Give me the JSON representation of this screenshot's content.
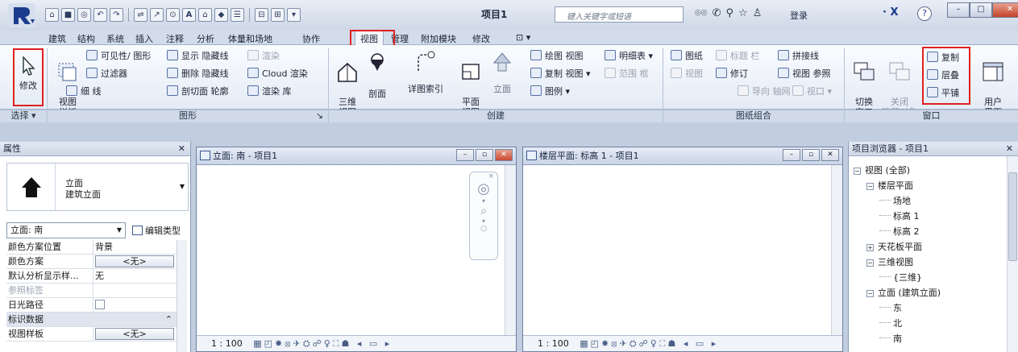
{
  "titlebar": {
    "doc_title": "项目1",
    "search_placeholder": "键入关键字或短语",
    "login_label": "登录",
    "help_label": "?"
  },
  "tabs": [
    "建筑",
    "结构",
    "系统",
    "插入",
    "注释",
    "分析",
    "体量和场地",
    "协作",
    "视图",
    "管理",
    "附加模块",
    "修改",
    "⊡ ▾"
  ],
  "active_tab": "视图",
  "ribbon": {
    "modify_label": "修改",
    "select_label": "选择 ▾",
    "graphics": {
      "group_label": "图形",
      "view_template": "视图\n样板",
      "items": [
        "可见性/ 图形",
        "过滤器",
        "细 线",
        "显示 隐藏线",
        "删除 隐藏线",
        "剖切面 轮廓",
        "渲染",
        "Cloud 渲染",
        "渲染 库"
      ]
    },
    "create": {
      "group_label": "创建",
      "three_d": "三维\n视图",
      "section": "剖面",
      "callout": "详图索引",
      "plan": "平面\n视图",
      "elevation": "立面",
      "drafting": "绘图 视图",
      "duplicate": "复制 视图 ▾",
      "legends": "图例 ▾",
      "schedules": "明细表 ▾",
      "scope_box": "范围 框"
    },
    "sheet": {
      "group_label": "图纸组合",
      "sheet": "图纸",
      "titleblock": "标题 栏",
      "view": "视图",
      "revision": "修订",
      "matchline": "拼接线",
      "view_ref": "视图 参照",
      "guide_grid": "导向 轴网",
      "viewport": "视口 ▾"
    },
    "window": {
      "group_label": "窗口",
      "switch": "切换\n窗口",
      "close_hidden": "关闭\n隐藏对象",
      "replicate": "复制",
      "cascade": "层叠",
      "tile": "平铺",
      "user_interface": "用户\n界面"
    }
  },
  "properties": {
    "title": "属性",
    "type_name_line1": "立面",
    "type_name_line2": "建筑立面",
    "selector": "立面: 南",
    "edit_type": "编辑类型",
    "rows": [
      {
        "key": "颜色方案位置",
        "value": "背景",
        "kind": "text"
      },
      {
        "key": "颜色方案",
        "value": "<无>",
        "kind": "button"
      },
      {
        "key": "默认分析显示样...",
        "value": "无",
        "kind": "text"
      },
      {
        "key": "参照标签",
        "value": "",
        "kind": "dim"
      },
      {
        "key": "日光路径",
        "value": "",
        "kind": "check"
      }
    ],
    "section_label": "标识数据",
    "view_template_key": "视图样板",
    "view_template_value": "<无>"
  },
  "view_south": {
    "title": "立面: 南 - 项目1",
    "scale": "1 : 100"
  },
  "view_level": {
    "title": "楼层平面: 标高 1 - 项目1",
    "scale": "1 : 100"
  },
  "browser": {
    "title": "项目浏览器 - 项目1",
    "nodes": [
      {
        "label": "视图 (全部)",
        "level": 0,
        "toggle": "⊟"
      },
      {
        "label": "楼层平面",
        "level": 1,
        "toggle": "⊟"
      },
      {
        "label": "场地",
        "level": 2,
        "toggle": ""
      },
      {
        "label": "标高 1",
        "level": 2,
        "toggle": ""
      },
      {
        "label": "标高 2",
        "level": 2,
        "toggle": ""
      },
      {
        "label": "天花板平面",
        "level": 1,
        "toggle": "⊞"
      },
      {
        "label": "三维视图",
        "level": 1,
        "toggle": "⊟"
      },
      {
        "label": "{三维}",
        "level": 2,
        "toggle": ""
      },
      {
        "label": "立面 (建筑立面)",
        "level": 1,
        "toggle": "⊟"
      },
      {
        "label": "东",
        "level": 2,
        "toggle": ""
      },
      {
        "label": "北",
        "level": 2,
        "toggle": ""
      },
      {
        "label": "南",
        "level": 2,
        "toggle": ""
      }
    ]
  },
  "colors": {
    "accent_red": "#e02020",
    "brand_blue": "#1a3b8a"
  }
}
